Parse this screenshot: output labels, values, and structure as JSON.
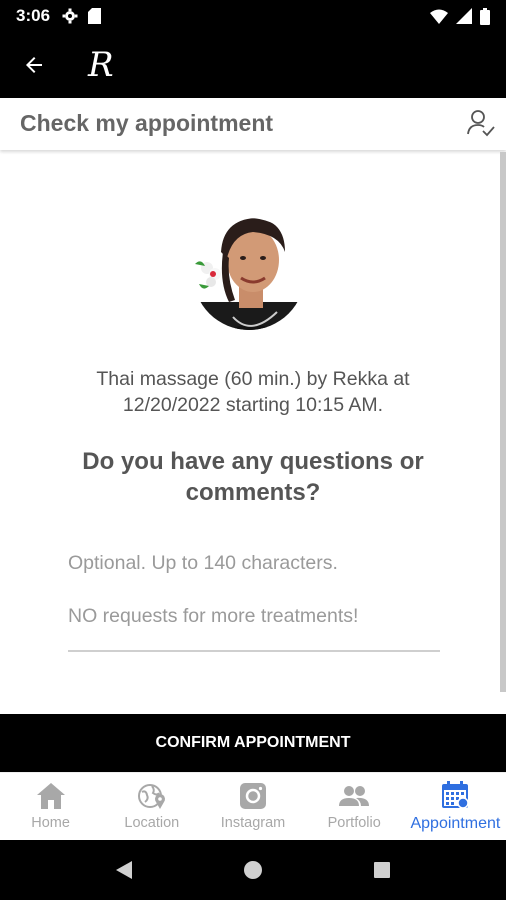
{
  "status_bar": {
    "time": "3:06",
    "icons": [
      "gear-icon",
      "sd-card-icon",
      "wifi-icon",
      "signal-icon",
      "battery-icon"
    ]
  },
  "app_bar": {
    "back_icon": "arrow-left-icon",
    "logo_text": "R"
  },
  "header": {
    "title": "Check my appointment",
    "account_icon": "user-check-icon"
  },
  "appointment": {
    "summary_line1": "Thai massage (60 min.) by Rekka at",
    "summary_line2": "12/20/2022 starting 10:15 AM."
  },
  "question": {
    "line1": "Do you have any questions or",
    "line2": "comments?"
  },
  "comment_field": {
    "placeholder_line1": "Optional. Up to 140 characters.",
    "placeholder_line2": "NO requests for more treatments!"
  },
  "confirm_button": {
    "label": "CONFIRM APPOINTMENT"
  },
  "bottom_nav": {
    "items": [
      {
        "label": "Home",
        "icon": "home-icon",
        "active": false
      },
      {
        "label": "Location",
        "icon": "globe-pin-icon",
        "active": false
      },
      {
        "label": "Instagram",
        "icon": "instagram-icon",
        "active": false
      },
      {
        "label": "Portfolio",
        "icon": "people-icon",
        "active": false
      },
      {
        "label": "Appointment",
        "icon": "calendar-icon",
        "active": true
      }
    ]
  },
  "colors": {
    "accent": "#2f6fe0",
    "inactive": "#a8a8a8",
    "bar": "#000000"
  }
}
